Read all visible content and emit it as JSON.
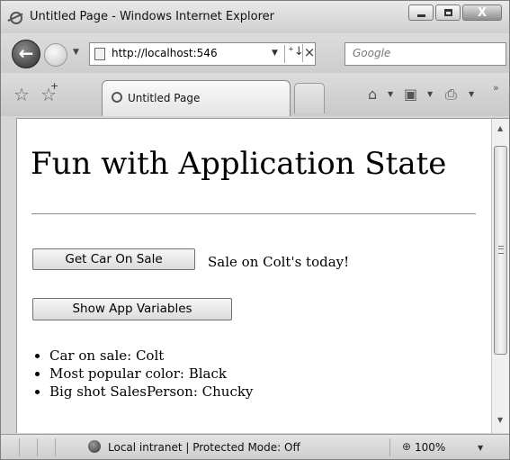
{
  "window": {
    "title": "Untitled Page - Windows Internet Explorer",
    "close_symbol": "X"
  },
  "address": {
    "url": "http://localhost:546",
    "refresh_symbol": "⁺↓",
    "stop_symbol": "×"
  },
  "search": {
    "placeholder": "Google"
  },
  "tab": {
    "label": "Untitled Page"
  },
  "page": {
    "heading": "Fun with Application State",
    "buttons": {
      "get_car": "Get Car On Sale",
      "show_vars": "Show App Variables"
    },
    "sale_message": "Sale on Colt's today!",
    "app_variables": [
      "Car on sale: Colt",
      "Most popular color: Black",
      "Big shot SalesPerson: Chucky"
    ]
  },
  "status": {
    "zone": "Local intranet | Protected Mode: Off",
    "zoom": "100%"
  },
  "icons": [
    "ie-logo-icon",
    "back-icon",
    "forward-icon",
    "favorites-star-icon",
    "add-favorites-icon",
    "home-icon",
    "feeds-icon",
    "print-icon",
    "globe-zone-icon",
    "zoom-icon"
  ]
}
